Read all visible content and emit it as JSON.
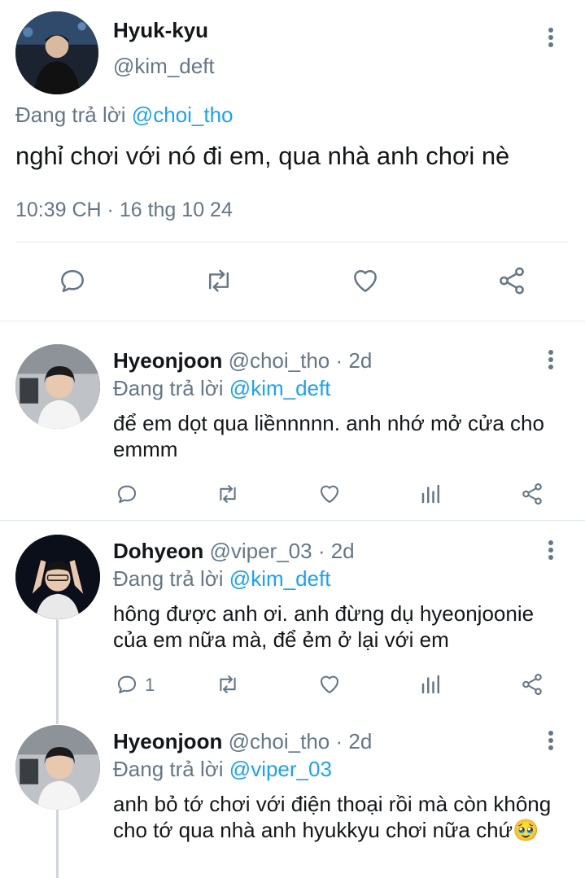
{
  "main_tweet": {
    "name": "Hyuk-kyu",
    "handle": "@kim_deft",
    "replying_prefix": "Đang trả lời",
    "replying_handle": "@choi_tho",
    "text": "nghỉ chơi với nó đi em, qua nhà anh chơi nè",
    "timestamp": "10:39 CH · 16 thg 10 24",
    "icons": [
      "reply-icon",
      "retweet-icon",
      "like-icon",
      "share-icon"
    ]
  },
  "replies": [
    {
      "name": "Hyeonjoon",
      "handle": "@choi_tho · 2d",
      "replying_prefix": "Đang trả lời",
      "replying_handle": "@kim_deft",
      "text": "để em dọt qua liềnnnnn. anh nhớ mở cửa cho emmm",
      "reply_count": ""
    },
    {
      "name": "Dohyeon",
      "handle": "@viper_03 · 2d",
      "replying_prefix": "Đang trả lời",
      "replying_handle": "@kim_deft",
      "text": "hông được anh ơi. anh đừng dụ hyeonjoonie của em nữa mà, để ẻm ở lại với em",
      "reply_count": "1"
    },
    {
      "name": "Hyeonjoon",
      "handle": "@choi_tho · 2d",
      "replying_prefix": "Đang trả lời",
      "replying_handle": "@viper_03",
      "text": "anh bỏ tớ chơi với điện thoại rồi mà còn không cho tớ qua nhà anh hyukkyu chơi nữa chứ🥹"
    }
  ],
  "colors": {
    "text": "#14171a",
    "secondary": "#657786",
    "link": "#1da1f2",
    "divider": "#e1e8ed"
  }
}
